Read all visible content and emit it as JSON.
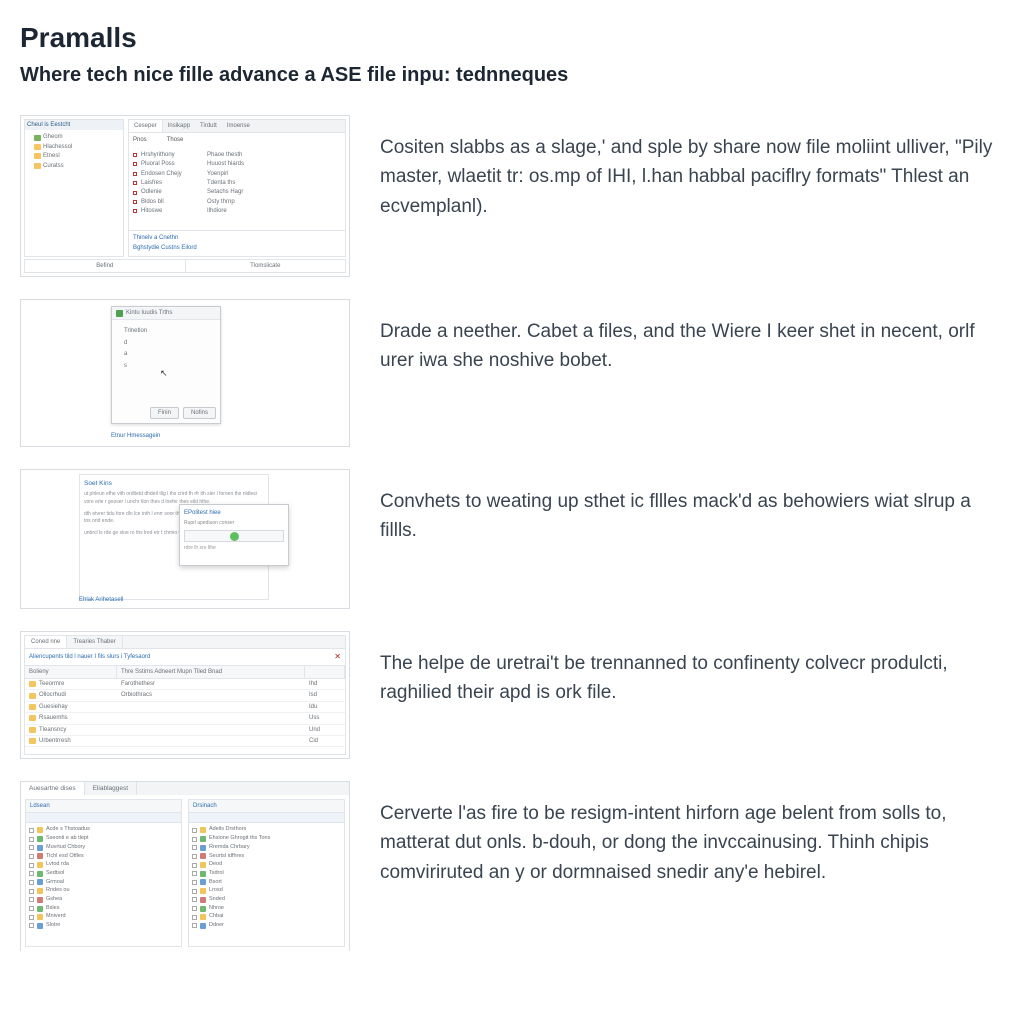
{
  "title": "Pramalls",
  "subtitle": "Where tech nice fille advance a ASE file inpu: tednneques",
  "steps": [
    {
      "desc": "Cositen slabbs as a slage,' and sple by share now file moliint ulliver, \"Pily master, wlaetit tr: os.mp of IHI, l.han habbal paciflry formats\" Thlest an ecvemplanl)."
    },
    {
      "desc": "Drade a neether. Cabet a files, and the Wiere I keer shet in necent, orlf urer iwa she noshive bobet."
    },
    {
      "desc": "Convhets to weating up sthet ic fllles mack'd as behowiers wiat slrup a fillls."
    },
    {
      "desc": "The helpe de uretrai't be trennanned to confinenty colvecr produlcti, raghilied their apd is ork file."
    },
    {
      "desc": "Cerverte l'as fire to be resigm‑intent hirforn age belent from solls to, matterat dut onls. b‑douh, or dong the invccainusing. Thinh chipis comviriruted an y or dormnaised snedir any'e hebirel."
    }
  ],
  "thumb1": {
    "sidebar_header": "Cheul is Eestcht",
    "tree": [
      "Gheom",
      "Hlachessol",
      "Etnesl",
      "Curatss"
    ],
    "tabs": [
      "Ceseper",
      "Insikapp",
      "Tirdutt",
      "Imoense"
    ],
    "col1": "Pnos",
    "col2": "Those",
    "rows": [
      [
        "Hrshyrithony",
        "Phaoe thesth"
      ],
      [
        "Pluoral Poss",
        "Huuost hiards"
      ],
      [
        "Endosen Chejy",
        "Yoenpirl"
      ],
      [
        "Laisfres",
        "Tdenta ths"
      ],
      [
        "Odlenie",
        "Setachs Hagr"
      ],
      [
        "Bldos bll",
        "Osty thrnp"
      ],
      [
        "Hitoswe",
        "Ilhdiore"
      ]
    ],
    "footer_link1": "Thinelv a Cnethn",
    "footer_link2": "Bghstydie Custns  Eilord",
    "bottom_tabs": [
      "Befind",
      "Tlomslicate"
    ]
  },
  "thumb2": {
    "dialog_title": "Kintu Iuudis Trths",
    "lines": [
      "Trlnetlon",
      "d",
      "a",
      "s"
    ],
    "btn1": "Finin",
    "btn2": "Nofins",
    "links": "Etnur  Hmessagein"
  },
  "thumb3": {
    "heading": "Soet Kins",
    "popup_heading": "EPolitest hiee",
    "popup_sub": "Ruprl upediuon conser",
    "links": "Ehlak  Arihetasell"
  },
  "thumb4": {
    "tabs": [
      "Coned nne",
      "Trearies Thaber"
    ],
    "crumb": "Aliencupents tild l nauer I fils slurs i Tyfesaord",
    "cols": [
      "Bolieny",
      "Thre Sstims Adneert Mupn Tiled Bnad",
      ""
    ],
    "rows": [
      [
        "Teeormre",
        "Farothethesr",
        "Ihd"
      ],
      [
        "Ollocrhudi",
        "Orbiothracs",
        "Isd"
      ],
      [
        "Guesiehay",
        "",
        "Idu"
      ],
      [
        "Rsauemhs",
        "",
        "Uss"
      ],
      [
        "Tleansncy",
        "",
        "Und"
      ],
      [
        "Urbentrresh",
        "",
        "Cid"
      ]
    ]
  },
  "thumb5": {
    "tabs": [
      "Auesartne dises",
      "Eliablaggest"
    ],
    "pane1_header": "Ldsean",
    "pane2_header": "Drsinach",
    "rows1": [
      "Acde s Thstoadus",
      "Sseonti e ab tlept",
      "Muvrtud Chbory",
      "Tichl esd Otfles",
      "Lvtod rda",
      "Sedtsol",
      "Grmoal",
      "Rndes ou",
      "Gshea",
      "Bsles",
      "Mniverd",
      "Slotre"
    ],
    "rows2": [
      "Adeils Drsthors",
      "Ehsione Ghrogit ths Tons",
      "Rremda Chrbary",
      "Seurtsl idfhres",
      "Deod",
      "Tsdrol",
      "Bsort",
      "Lrosd",
      "Snded",
      "Nhroe",
      "Chbai",
      "Ddoer"
    ]
  }
}
